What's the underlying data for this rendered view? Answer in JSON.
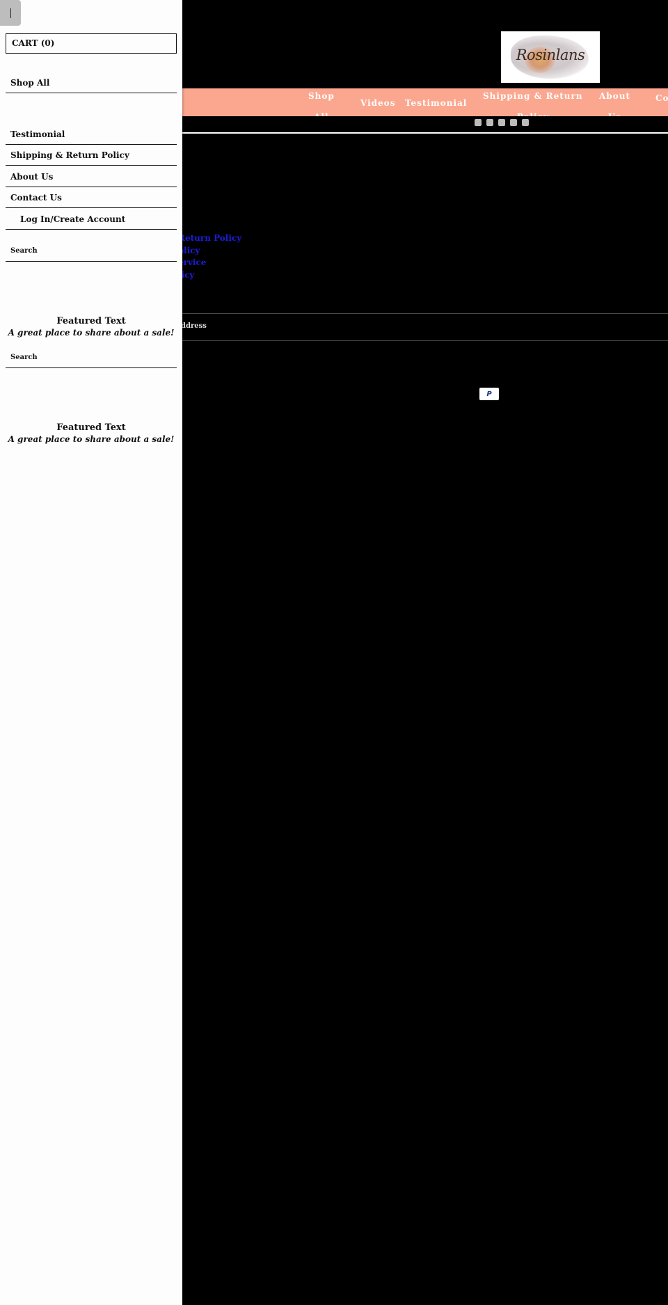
{
  "brand": {
    "logo_text": "Rosinlans"
  },
  "drawer": {
    "cart_label": "CART (0)",
    "menu": [
      "Shop All",
      "Testimonial",
      "Shipping & Return Policy",
      "About Us",
      "Contact Us",
      "Log In/Create Account"
    ],
    "search_label": "Search",
    "featured_title": "Featured Text",
    "featured_subtitle": "A great place to share about a sale!"
  },
  "nav": {
    "shop_l1": "Shop",
    "shop_l2": "All",
    "videos": "Videos",
    "testimonial": "Testimonial",
    "shipping_l1": "Shipping & Return",
    "shipping_l2": "Policy",
    "about_l1": "About",
    "about_l2": "Us",
    "contact_clip": "Co"
  },
  "footer": {
    "links": [
      "Return Policy",
      "olicy",
      "ervice",
      "licy"
    ],
    "clipped_text": "ddress",
    "payment_icon": "PayPal"
  }
}
